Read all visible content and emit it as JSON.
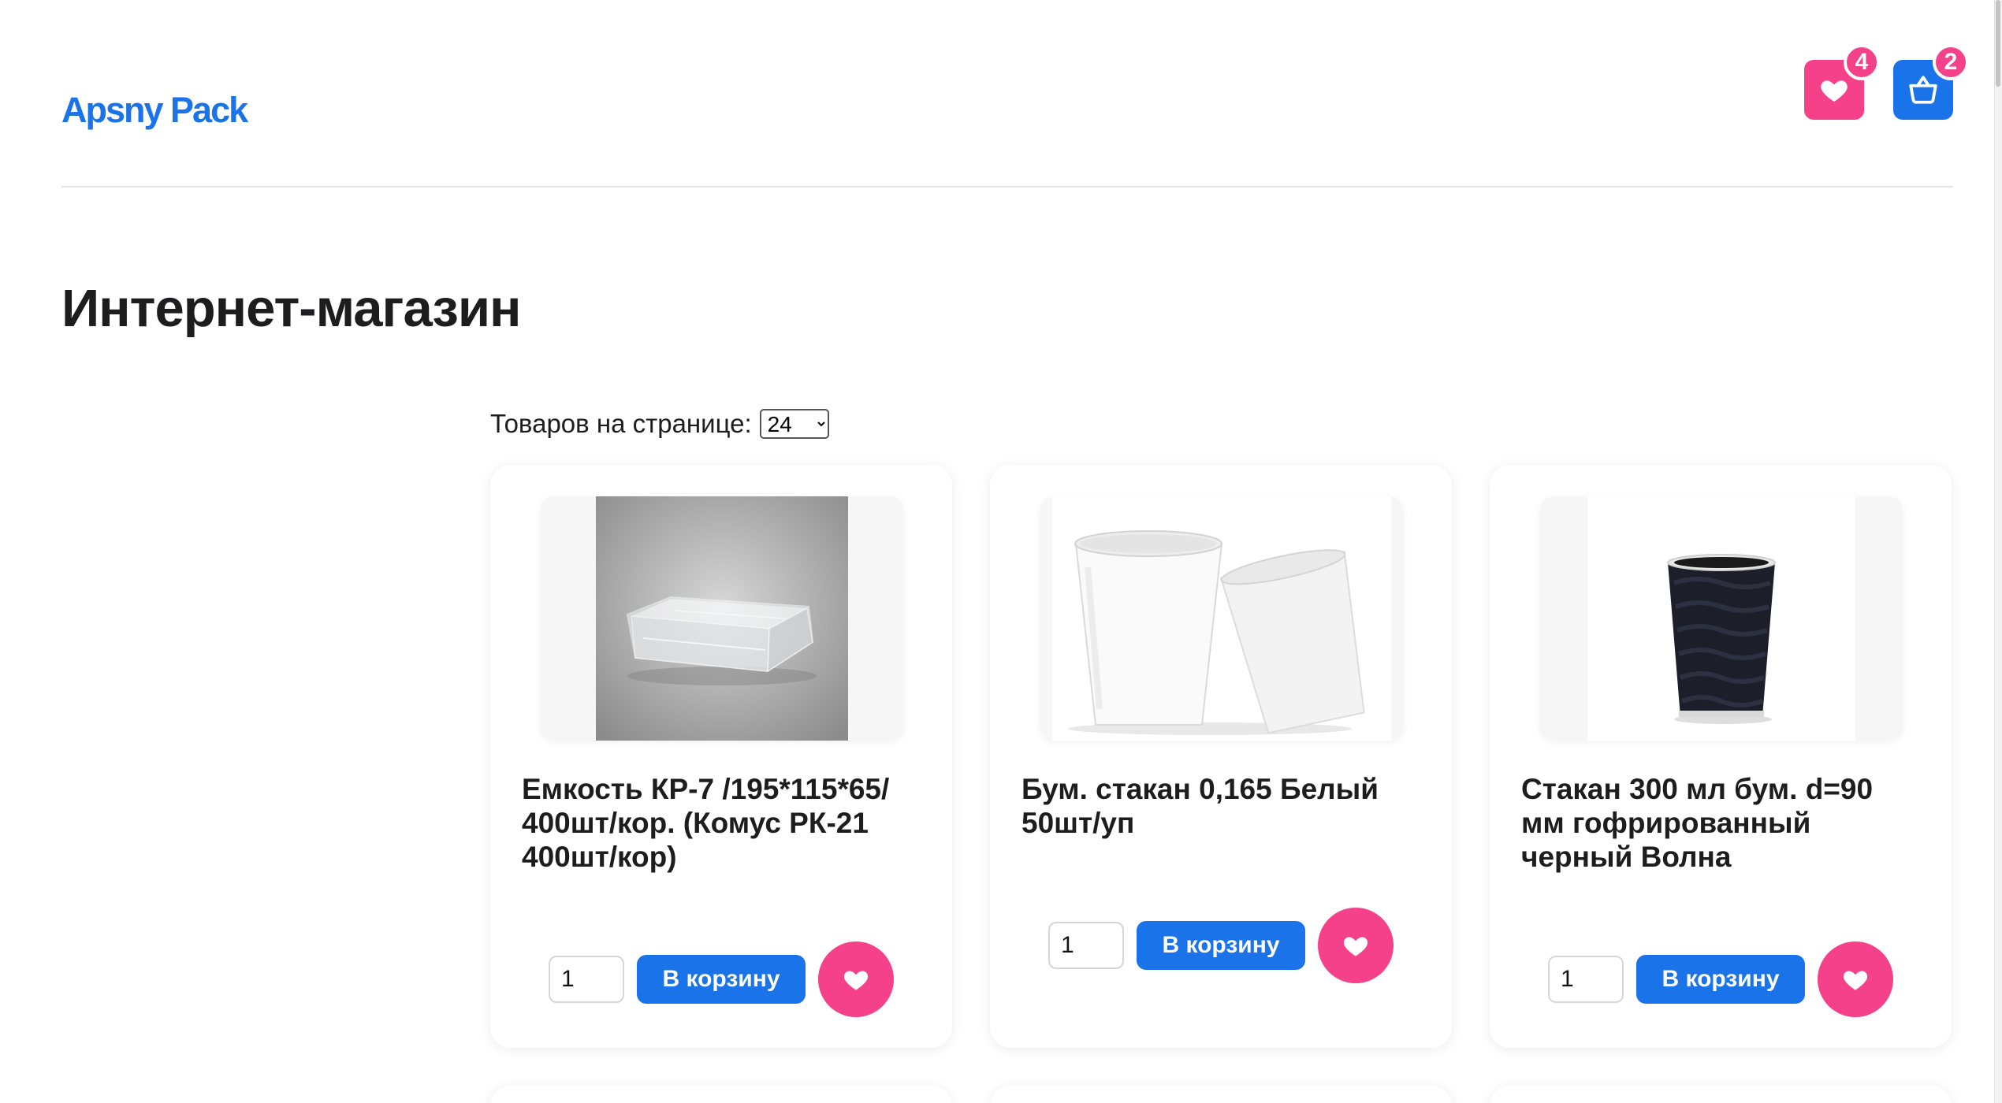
{
  "header": {
    "logo": "Apsny Pack",
    "favorites_count": "4",
    "cart_count": "2"
  },
  "main": {
    "title": "Интернет-магазин",
    "per_page_label": "Товаров на странице:",
    "per_page_value": "24"
  },
  "products": [
    {
      "name": "Емкость КР-7 /195*115*65/ 400шт/кор. (Комус РК-21 400шт/кор)",
      "qty": "1",
      "add_label": "В корзину",
      "image": "clear-plastic-container"
    },
    {
      "name": "Бум. стакан 0,165 Белый 50шт/уп",
      "qty": "1",
      "add_label": "В корзину",
      "image": "white-paper-cups"
    },
    {
      "name": "Стакан 300 мл бум. d=90 мм гофрированный черный Волна",
      "qty": "1",
      "add_label": "В корзину",
      "image": "black-ripple-cup"
    }
  ],
  "colors": {
    "brand_blue": "#1a73e8",
    "favorite_pink": "#f5408a"
  }
}
